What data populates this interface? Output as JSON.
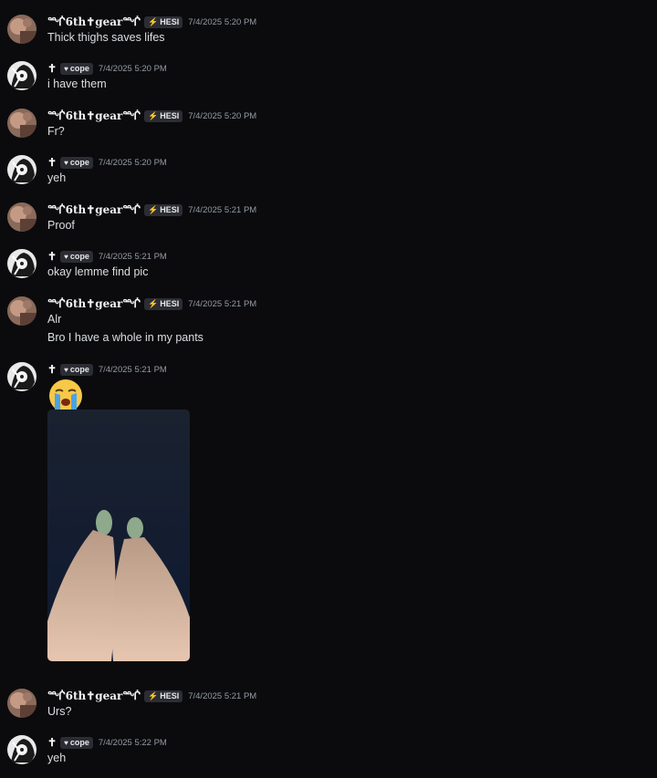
{
  "users": {
    "a": {
      "name": "ᙲ6th✝gearᙲ",
      "tag_icon": "lightning-icon",
      "tag_label": "HESI",
      "avatar": "avatar-photo-a"
    },
    "b": {
      "name": "✝",
      "tag_icon": "heart-icon",
      "tag_label": "cope",
      "avatar": "avatar-bw-b"
    }
  },
  "messages": [
    {
      "user": "a",
      "time": "7/4/2025 5:20 PM",
      "lines": [
        "Thick thighs saves lifes"
      ]
    },
    {
      "user": "b",
      "time": "7/4/2025 5:20 PM",
      "lines": [
        "i have them"
      ]
    },
    {
      "user": "a",
      "time": "7/4/2025 5:20 PM",
      "lines": [
        "Fr?"
      ]
    },
    {
      "user": "b",
      "time": "7/4/2025 5:20 PM",
      "lines": [
        "yeh"
      ]
    },
    {
      "user": "a",
      "time": "7/4/2025 5:21 PM",
      "lines": [
        "Proof"
      ]
    },
    {
      "user": "b",
      "time": "7/4/2025 5:21 PM",
      "lines": [
        "okay lemme find pic"
      ]
    },
    {
      "user": "a",
      "time": "7/4/2025 5:21 PM",
      "lines": [
        "Alr",
        "Bro I have a whole in my pants"
      ]
    },
    {
      "user": "b",
      "time": "7/4/2025 5:21 PM",
      "lines": [],
      "emoji": "loudly-crying-face",
      "attachment": "photo"
    },
    {
      "user": "a",
      "time": "7/4/2025 5:21 PM",
      "lines": [
        "Urs?"
      ]
    },
    {
      "user": "b",
      "time": "7/4/2025 5:22 PM",
      "lines": [
        "yeh"
      ]
    }
  ],
  "colors": {
    "background": "#0b0b0d",
    "hesi_icon": "#a78bfa",
    "timestamp": "#949ba4"
  }
}
